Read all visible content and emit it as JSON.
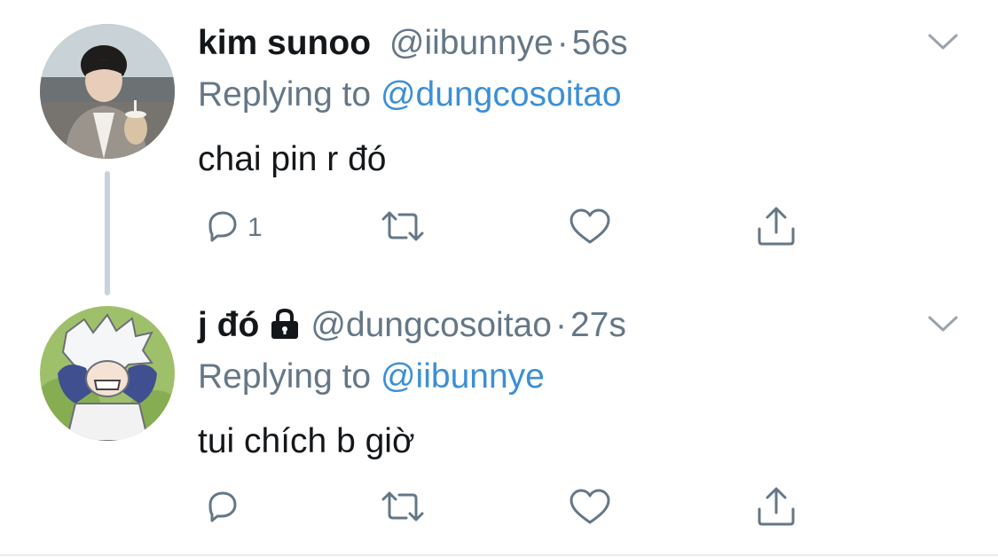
{
  "tweets": [
    {
      "display_name": "kim sunoo",
      "handle": "@iibunnye",
      "separator": "·",
      "time": "56s",
      "replying_prefix": "Replying to",
      "replying_to": "@dungcosoitao",
      "text": "chai pin r đó",
      "reply_count": "1",
      "protected": false
    },
    {
      "display_name": "j đó",
      "handle": "@dungcosoitao",
      "separator": "·",
      "time": "27s",
      "replying_prefix": "Replying to",
      "replying_to": "@iibunnye",
      "text": "tui chích b giờ",
      "reply_count": "",
      "protected": true
    }
  ],
  "colors": {
    "accent": "#3c8fd6",
    "secondary_text": "#657786",
    "primary_text": "#14171a",
    "thread_line": "#c8d2da"
  },
  "icons": [
    "chevron-down-icon",
    "reply-icon",
    "retweet-icon",
    "like-icon",
    "share-icon",
    "lock-icon"
  ]
}
